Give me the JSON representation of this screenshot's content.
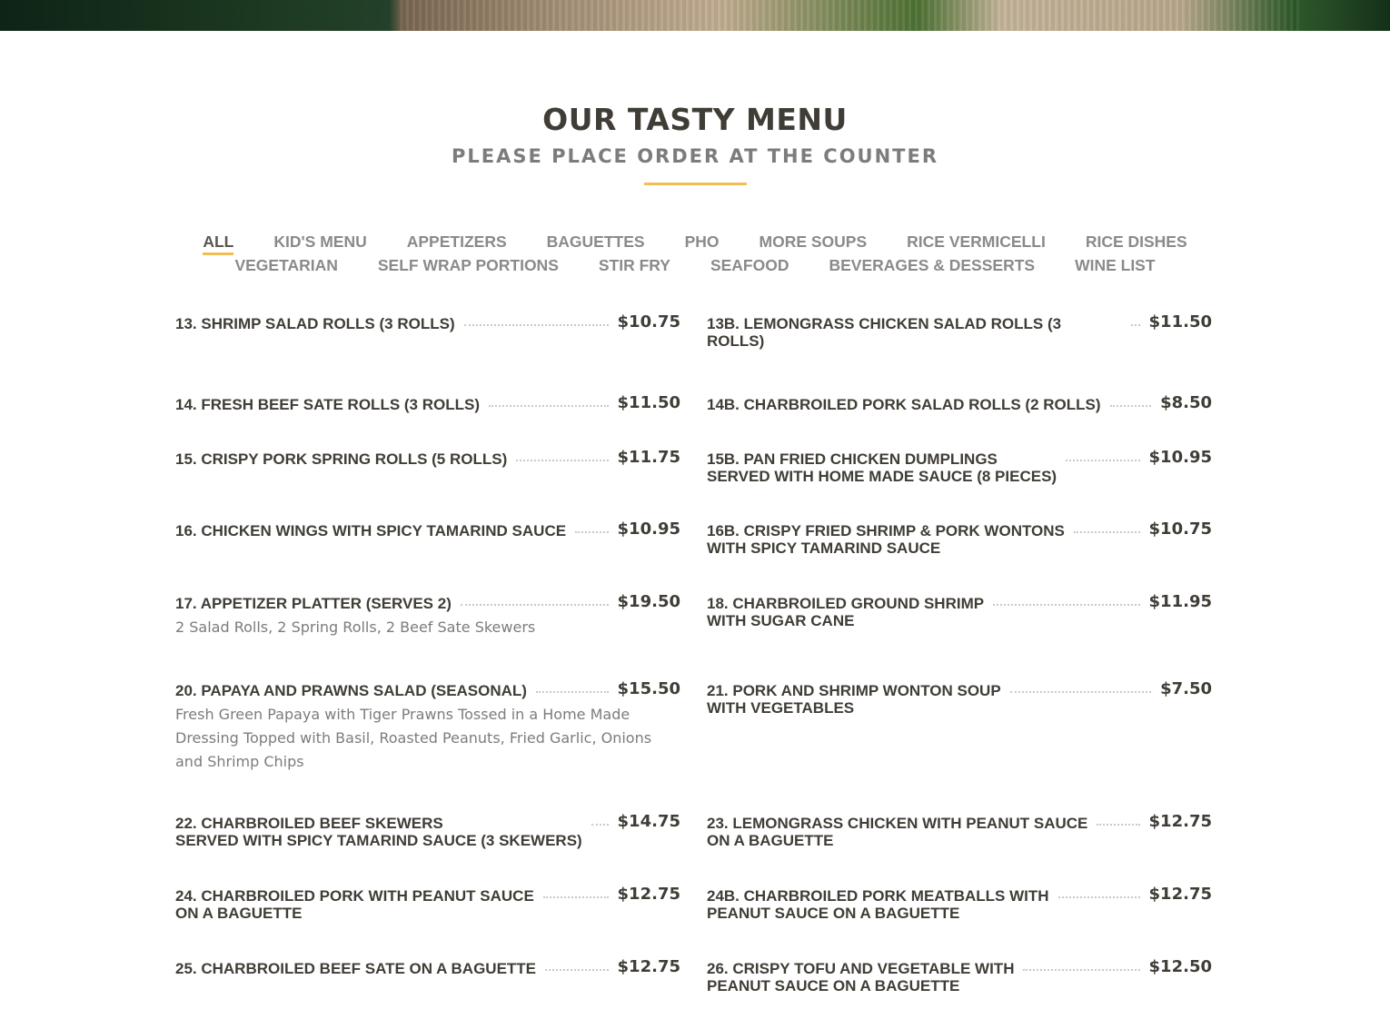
{
  "header": {
    "title": "OUR TASTY MENU",
    "subtitle": "PLEASE PLACE ORDER AT THE COUNTER",
    "accent_color": "#f2bf55"
  },
  "tabs": {
    "row1": [
      "ALL",
      "KID'S MENU",
      "APPETIZERS",
      "BAGUETTES",
      "PHO",
      "MORE SOUPS",
      "RICE VERMICELLI",
      "RICE DISHES"
    ],
    "row2": [
      "VEGETARIAN",
      "SELF WRAP PORTIONS",
      "STIR FRY",
      "SEAFOOD",
      "BEVERAGES & DESSERTS",
      "WINE LIST"
    ],
    "active": "ALL"
  },
  "menu": {
    "left": [
      {
        "name": "13. SHRIMP SALAD ROLLS (3 ROLLS)",
        "price": "$10.75"
      },
      {
        "name": "14. FRESH BEEF SATE ROLLS (3 ROLLS)",
        "price": "$11.50"
      },
      {
        "name": "15. CRISPY PORK SPRING ROLLS (5 ROLLS)",
        "price": "$11.75"
      },
      {
        "name": "16. CHICKEN WINGS WITH SPICY TAMARIND SAUCE",
        "price": "$10.95"
      },
      {
        "name": "17. APPETIZER PLATTER (SERVES 2)",
        "price": "$19.50",
        "desc": "2 Salad Rolls, 2 Spring Rolls, 2 Beef Sate Skewers"
      },
      {
        "name": "20. PAPAYA AND PRAWNS SALAD (SEASONAL)",
        "price": "$15.50",
        "desc": "Fresh Green Papaya with Tiger Prawns Tossed in a Home Made Dressing Topped with Basil, Roasted Peanuts, Fried Garlic, Onions and Shrimp Chips"
      },
      {
        "name": "22. CHARBROILED BEEF SKEWERS\nSERVED WITH SPICY TAMARIND SAUCE (3 SKEWERS)",
        "price": "$14.75"
      },
      {
        "name": "24. CHARBROILED PORK WITH PEANUT SAUCE\nON A BAGUETTE",
        "price": "$12.75"
      },
      {
        "name": "25. CHARBROILED BEEF SATE ON A BAGUETTE",
        "price": "$12.75"
      }
    ],
    "right": [
      {
        "name": "13B. LEMONGRASS CHICKEN SALAD ROLLS (3 ROLLS)",
        "price": "$11.50"
      },
      {
        "name": "14B. CHARBROILED PORK SALAD ROLLS (2 ROLLS)",
        "price": "$8.50"
      },
      {
        "name": "15B. PAN FRIED CHICKEN DUMPLINGS\nSERVED WITH HOME MADE SAUCE (8 PIECES)",
        "price": "$10.95"
      },
      {
        "name": "16B. CRISPY FRIED SHRIMP & PORK WONTONS\nWITH SPICY TAMARIND SAUCE",
        "price": "$10.75"
      },
      {
        "name": "18. CHARBROILED GROUND SHRIMP\nWITH SUGAR CANE",
        "price": "$11.95"
      },
      {
        "name": "21. PORK AND SHRIMP WONTON SOUP\nWITH VEGETABLES",
        "price": "$7.50"
      },
      {
        "name": "23. LEMONGRASS CHICKEN WITH PEANUT SAUCE\nON A BAGUETTE",
        "price": "$12.75"
      },
      {
        "name": "24B. CHARBROILED PORK MEATBALLS WITH\nPEANUT SAUCE ON A BAGUETTE",
        "price": "$12.75"
      },
      {
        "name": "26. CRISPY TOFU AND VEGETABLE WITH\nPEANUT SAUCE ON A BAGUETTE",
        "price": "$12.50"
      }
    ]
  }
}
